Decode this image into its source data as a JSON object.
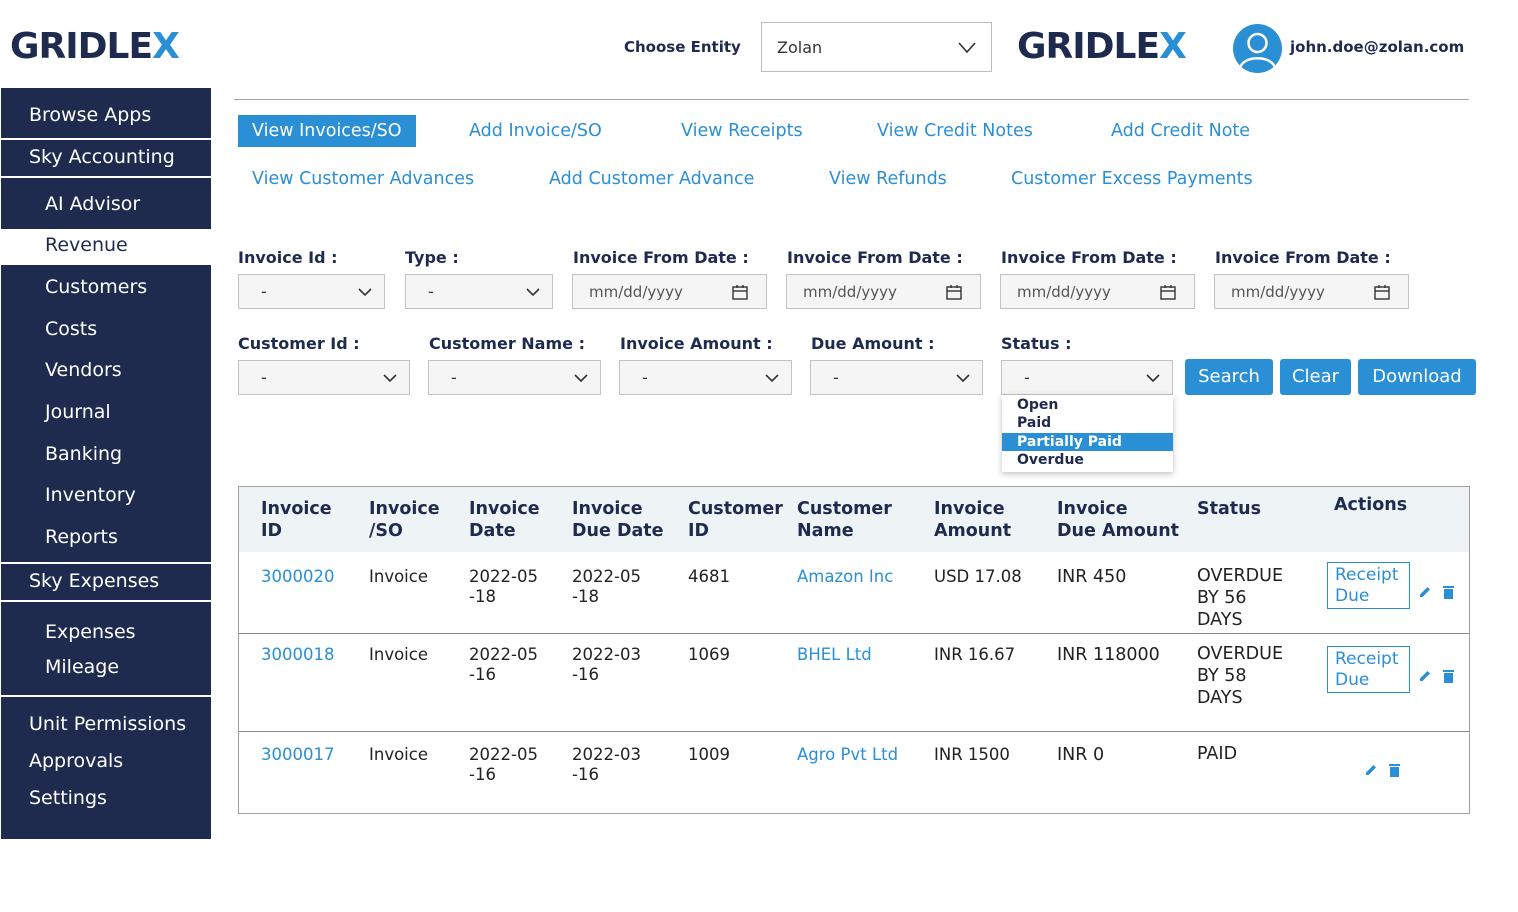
{
  "header": {
    "logo_left": "GRIDLE",
    "logo_x": "X",
    "logo_right_main": "GRIDLE",
    "logo_right_x": "X",
    "entity_label": "Choose Entity",
    "entity_value": "Zolan",
    "user_email": "john.doe@zolan.com"
  },
  "sidebar": {
    "browse_apps": "Browse Apps",
    "sky_accounting": "Sky Accounting",
    "accounting_items": [
      "AI Advisor",
      "Revenue",
      "Customers",
      "Costs",
      "Vendors",
      "Journal",
      "Banking",
      "Inventory",
      "Reports"
    ],
    "active_item": "Revenue",
    "sky_expenses": "Sky Expenses",
    "expenses_items": [
      "Expenses",
      "Mileage"
    ],
    "bottom_items": [
      "Unit Permissions",
      "Approvals",
      "Settings"
    ]
  },
  "nav": {
    "row1": [
      "View Invoices/SO",
      "Add Invoice/SO",
      "View Receipts",
      "View Credit Notes",
      "Add Credit Note"
    ],
    "row2": [
      "View Customer Advances",
      "Add Customer Advance",
      "View Refunds",
      "Customer Excess Payments"
    ],
    "active": "View Invoices/SO"
  },
  "filters": {
    "invoice_id": {
      "label": "Invoice Id :",
      "value": "-"
    },
    "type": {
      "label": "Type :",
      "value": "-"
    },
    "date1": {
      "label": "Invoice From Date :",
      "placeholder": "mm/dd/yyyy"
    },
    "date2": {
      "label": "Invoice From Date :",
      "placeholder": "mm/dd/yyyy"
    },
    "date3": {
      "label": "Invoice From Date :",
      "placeholder": "mm/dd/yyyy"
    },
    "date4": {
      "label": "Invoice From Date :",
      "placeholder": "mm/dd/yyyy"
    },
    "customer_id": {
      "label": "Customer Id :",
      "value": "-"
    },
    "customer_name": {
      "label": "Customer Name :",
      "value": "-"
    },
    "invoice_amount": {
      "label": "Invoice Amount :",
      "value": "-"
    },
    "due_amount": {
      "label": "Due Amount :",
      "value": "-"
    },
    "status": {
      "label": "Status :",
      "value": "-",
      "options": [
        "Open",
        "Paid",
        "Partially Paid",
        "Overdue"
      ],
      "highlighted": "Partially Paid"
    },
    "buttons": {
      "search": "Search",
      "clear": "Clear",
      "download": "Download"
    }
  },
  "table": {
    "headers": {
      "invoice_id": [
        "Invoice",
        "ID"
      ],
      "invoice_so": [
        "Invoice",
        "/SO"
      ],
      "invoice_date": [
        "Invoice",
        "Date"
      ],
      "due_date": [
        "Invoice",
        "Due Date"
      ],
      "customer_id": [
        "Customer",
        "ID"
      ],
      "customer_name": [
        "Customer",
        "Name"
      ],
      "invoice_amount": [
        "Invoice",
        "Amount"
      ],
      "due_amount": [
        "Invoice",
        "Due Amount"
      ],
      "status": "Status",
      "actions": "Actions"
    },
    "rows": [
      {
        "invoice_id": "3000020",
        "type": "Invoice",
        "date": [
          "2022-05",
          "-18"
        ],
        "due_date": [
          "2022-05",
          "-18"
        ],
        "customer_id": "4681",
        "customer_name": "Amazon Inc",
        "amount": "USD 17.08",
        "due_amount": "INR 450",
        "status": [
          "OVERDUE",
          "BY 56",
          "DAYS"
        ],
        "receipt": [
          "Receipt",
          "Due"
        ]
      },
      {
        "invoice_id": "3000018",
        "type": "Invoice",
        "date": [
          "2022-05",
          "-16"
        ],
        "due_date": [
          "2022-03",
          "-16"
        ],
        "customer_id": "1069",
        "customer_name": "BHEL Ltd",
        "amount": "INR 16.67",
        "due_amount": "INR 118000",
        "status": [
          "OVERDUE",
          "BY 58",
          "DAYS"
        ],
        "receipt": [
          "Receipt",
          "Due"
        ]
      },
      {
        "invoice_id": "3000017",
        "type": "Invoice",
        "date": [
          "2022-05",
          "-16"
        ],
        "due_date": [
          "2022-03",
          "-16"
        ],
        "customer_id": "1009",
        "customer_name": "Agro Pvt Ltd",
        "amount": "INR 1500",
        "due_amount": "INR 0",
        "status": [
          "PAID"
        ]
      }
    ]
  },
  "colors": {
    "navy": "#1e2b4f",
    "accent": "#2a8fd4"
  },
  "icons": [
    "chevron-down-icon",
    "calendar-icon",
    "user-avatar-icon",
    "edit-pencil-icon",
    "trash-icon"
  ]
}
